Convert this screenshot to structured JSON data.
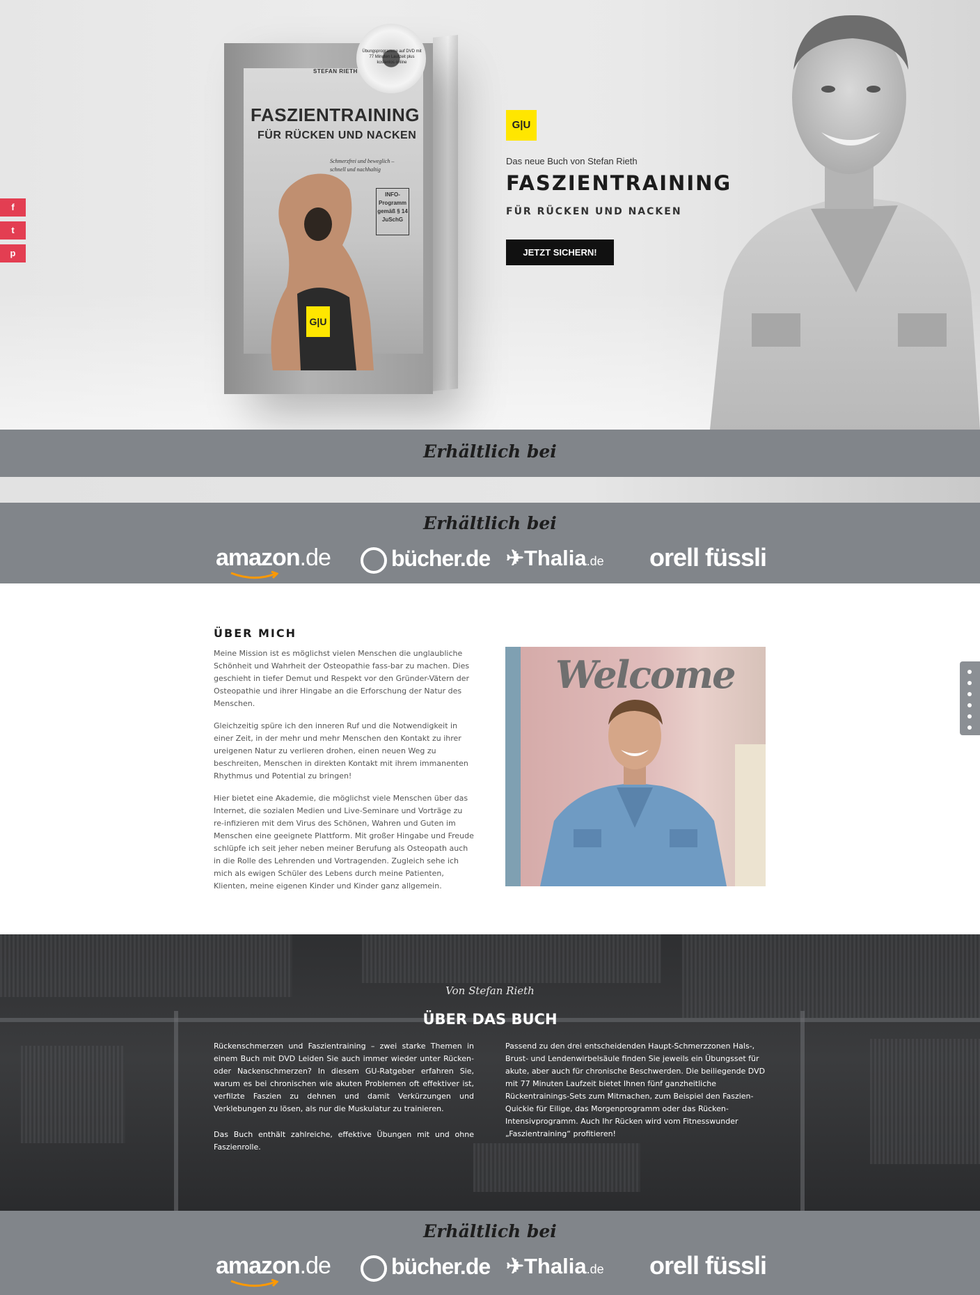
{
  "hero": {
    "publisher_badge": "G|U",
    "kicker": "Das neue Buch von Stefan Rieth",
    "title": "FASZIENTRAINING",
    "subtitle": "FÜR RÜCKEN UND NACKEN",
    "cta_label": "JETZT SICHERN!"
  },
  "book_cover": {
    "author": "STEFAN RIETH",
    "title": "FASZIENTRAINING",
    "subtitle": "FÜR RÜCKEN UND NACKEN",
    "tagline": "Schmerzfrei und beweglich – schnell und nachhaltig",
    "info_box": "INFO-Programm gemäß § 14 JuSchG",
    "dvd_text": "Übungsprogramme auf DVD mit 77 Minuten Laufzeit plus kostenlos online",
    "publisher": "G|U"
  },
  "social": [
    {
      "icon": "facebook-icon",
      "glyph": "f"
    },
    {
      "icon": "twitter-icon",
      "glyph": "t"
    },
    {
      "icon": "pinterest-icon",
      "glyph": "p"
    }
  ],
  "shops_band": {
    "title": "Erhältlich bei",
    "shops": [
      {
        "name": "amazon",
        "suffix": ".de"
      },
      {
        "name": "bücher",
        "suffix": ".de"
      },
      {
        "name": "Thalia",
        "suffix": ".de"
      },
      {
        "name": "orell füssli",
        "suffix": ""
      }
    ]
  },
  "about": {
    "heading": "ÜBER MICH",
    "paragraphs": [
      "Meine Mission ist es möglichst vielen Menschen die unglaubliche Schönheit und Wahrheit der Osteopathie fass-bar zu machen. Dies geschieht in tiefer Demut und Respekt vor den Gründer-Vätern der Osteopathie und ihrer Hingabe an die Erforschung der Natur des Menschen.",
      "Gleichzeitig spüre ich den inneren Ruf und die Notwendigkeit in einer Zeit, in der mehr und mehr Menschen den Kontakt zu ihrer ureigenen Natur zu verlieren drohen, einen neuen Weg zu beschreiten, Menschen in direkten Kontakt mit ihrem immanenten Rhythmus und Potential zu bringen!",
      "Hier bietet eine Akademie, die möglichst viele Menschen über das Internet, die sozialen Medien und Live-Seminare und Vorträge zu re-infizieren mit dem Virus des Schönen, Wahren und Guten im Menschen eine geeignete Plattform. Mit großer Hingabe und Freude schlüpfe ich seit jeher neben meiner Berufung als Osteopath auch in die Rolle des Lehrenden und Vortragenden. Zugleich sehe ich mich als ewigen Schüler des Lebens durch meine Patienten, Klienten, meine eigenen Kinder und Kinder ganz allgemein."
    ],
    "photo_sign": "Welcome"
  },
  "book_section": {
    "kicker": "Von Stefan Rieth",
    "heading": "ÜBER DAS BUCH",
    "left_paragraphs": [
      "Rückenschmerzen und Faszientraining – zwei starke Themen in einem Buch mit DVD Leiden Sie auch immer wieder unter Rücken- oder Nackenschmerzen? In diesem GU-Ratgeber erfahren Sie, warum es bei chronischen wie akuten Problemen oft effektiver ist, verfilzte Faszien zu dehnen und damit Verkürzungen und Verklebungen zu lösen, als nur die Muskulatur zu trainieren.",
      "Das Buch enthält zahlreiche, effektive Übungen mit und ohne Faszienrolle."
    ],
    "right_paragraph": "Passend zu den drei entscheidenden Haupt-Schmerzzonen Hals-, Brust- und Lendenwirbelsäule finden Sie jeweils ein Übungsset für akute, aber auch für chronische Beschwerden. Die beiliegende DVD mit 77 Minuten Laufzeit bietet Ihnen fünf ganzheitliche Rückentrainings-Sets zum Mitmachen, zum Beispiel den Faszien-Quickie für Eilige, das Morgenprogramm oder das Rücken-Intensivprogramm. Auch Ihr Rücken wird vom Fitnesswunder „Faszientraining“ profitieren!"
  },
  "colors": {
    "band": "#81858a",
    "accent_yellow": "#ffe600",
    "social_red": "#e33e52",
    "cta_black": "#111111"
  }
}
